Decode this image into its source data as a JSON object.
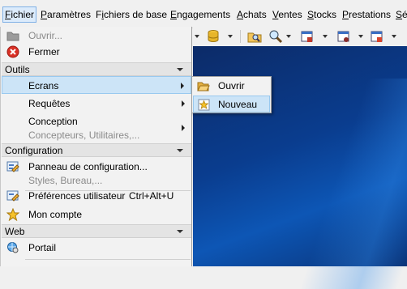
{
  "menubar": {
    "items": [
      {
        "label": "Fichier",
        "accel": "F"
      },
      {
        "label": "Paramètres",
        "accel": "P"
      },
      {
        "label": "Fichiers de base",
        "accel": "i"
      },
      {
        "label": "Engagements",
        "accel": "E"
      },
      {
        "label": "Achats",
        "accel": "A"
      },
      {
        "label": "Ventes",
        "accel": "V"
      },
      {
        "label": "Stocks",
        "accel": "S"
      },
      {
        "label": "Prestations",
        "accel": "P"
      },
      {
        "label": "Sé",
        "accel": "S"
      }
    ]
  },
  "fichier_menu": {
    "open": {
      "label": "Ouvrir..."
    },
    "close": {
      "label": "Fermer"
    },
    "sections": {
      "outils": "Outils",
      "configuration": "Configuration",
      "web": "Web"
    },
    "ecrans": {
      "label": "Ecrans"
    },
    "requetes": {
      "label": "Requêtes"
    },
    "conception": {
      "label": "Conception",
      "subtitle": "Concepteurs, Utilitaires,..."
    },
    "panneau": {
      "label": "Panneau de configuration...",
      "subtitle": "Styles, Bureau,..."
    },
    "preferences": {
      "label": "Préférences utilisateur",
      "shortcut": "Ctrl+Alt+U"
    },
    "compte": {
      "label": "Mon compte"
    },
    "portail": {
      "label": "Portail"
    }
  },
  "ecrans_submenu": {
    "ouvrir": {
      "label": "Ouvrir"
    },
    "nouveau": {
      "label": "Nouveau"
    }
  },
  "colors": {
    "highlight": "#cce4f7",
    "highlight_border": "#99c9ef",
    "desktop": "#0a3d8f"
  }
}
